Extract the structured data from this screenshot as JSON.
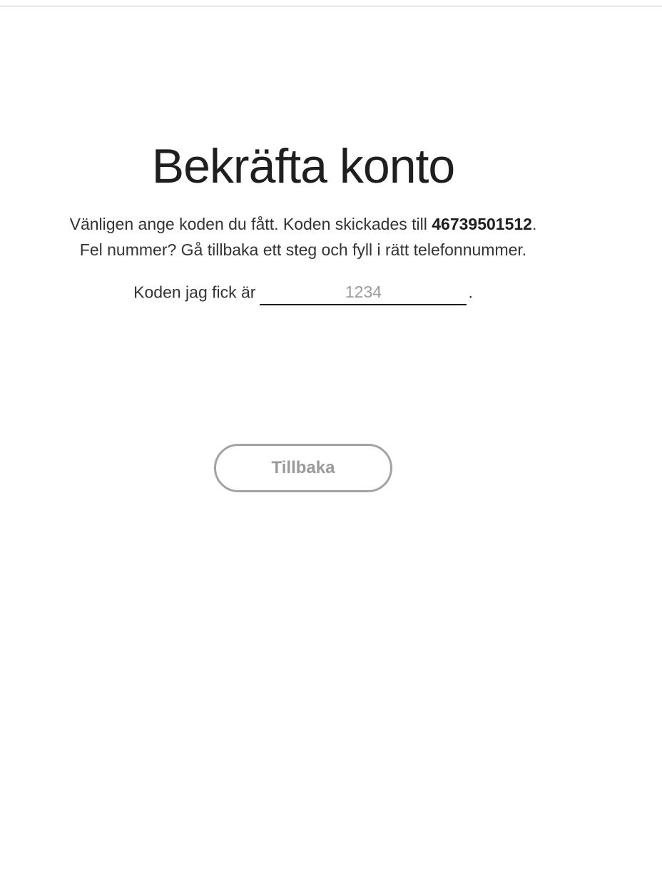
{
  "header": {
    "title": "Bekräfta konto"
  },
  "instructions": {
    "line1_text": "Vänligen ange koden du fått. Koden skickades till ",
    "phone_number": "46739501512",
    "line1_end": ".",
    "line2_text": "Fel nummer? Gå tillbaka ett steg och fyll i rätt telefonnummer."
  },
  "code_entry": {
    "label": "Koden jag fick är",
    "placeholder": "1234",
    "value": "",
    "suffix": "."
  },
  "actions": {
    "back_label": "Tillbaka"
  }
}
